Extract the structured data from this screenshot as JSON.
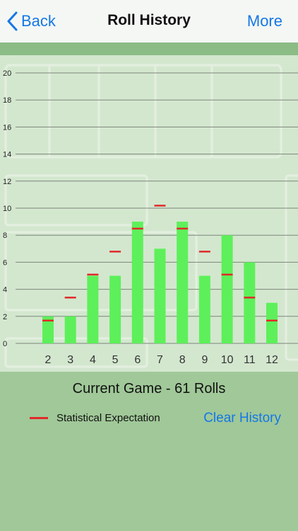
{
  "nav": {
    "back_label": "Back",
    "title": "Roll History",
    "more_label": "More"
  },
  "colors": {
    "accent": "#1577e6",
    "bar": "#5df05a",
    "expectation": "#e02a2a"
  },
  "chart_data": {
    "type": "bar",
    "categories": [
      "2",
      "3",
      "4",
      "5",
      "6",
      "7",
      "8",
      "9",
      "10",
      "11",
      "12"
    ],
    "series": [
      {
        "name": "",
        "values": [
          2,
          2,
          5,
          5,
          9,
          7,
          9,
          5,
          8,
          6,
          3
        ]
      }
    ],
    "expected": [
      1.7,
      3.4,
      5.1,
      6.8,
      8.5,
      10.2,
      8.5,
      6.8,
      5.1,
      3.4,
      1.7
    ],
    "ylim": [
      0,
      20
    ],
    "yticks": [
      0,
      2,
      4,
      6,
      8,
      10,
      12,
      14,
      16,
      18,
      20
    ],
    "title": "",
    "xlabel": "",
    "ylabel": "",
    "grid": true
  },
  "game_label": "Current Game - 61 Rolls",
  "legend_label": "Statistical Expectation",
  "clear_label": "Clear History"
}
